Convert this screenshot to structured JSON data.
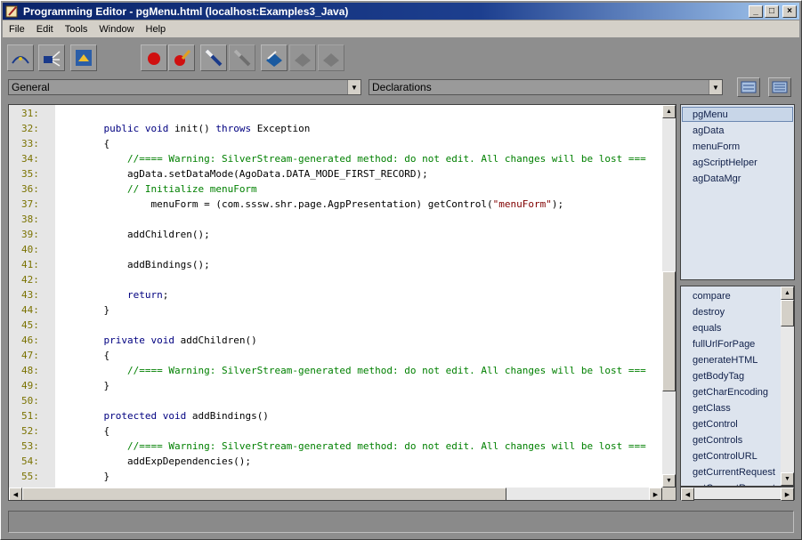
{
  "window": {
    "title": "Programming Editor - pgMenu.html  (localhost:Examples3_Java)"
  },
  "title_buttons": {
    "minimize": "_",
    "maximize": "□",
    "close": "×"
  },
  "menu": [
    "File",
    "Edit",
    "Tools",
    "Window",
    "Help"
  ],
  "toolbar": {
    "icons": [
      "compile-icon",
      "debug-icon",
      "deploy-icon",
      "breakpoint-icon",
      "clear-breakpoint-icon",
      "step-into-icon",
      "step-over-icon",
      "bookmark-icon",
      "prev-bookmark-icon",
      "next-bookmark-icon"
    ]
  },
  "selectors": {
    "object": "General",
    "procedure": "Declarations"
  },
  "editor": {
    "lines": [
      {
        "n": "31:",
        "parts": [
          {
            "t": "",
            "c": ""
          }
        ]
      },
      {
        "n": "32:",
        "parts": [
          {
            "t": "    ",
            "c": ""
          },
          {
            "t": "public void",
            "c": "kw"
          },
          {
            "t": " init() ",
            "c": ""
          },
          {
            "t": "throws",
            "c": "kw"
          },
          {
            "t": " Exception",
            "c": ""
          }
        ]
      },
      {
        "n": "33:",
        "parts": [
          {
            "t": "    {",
            "c": ""
          }
        ]
      },
      {
        "n": "34:",
        "parts": [
          {
            "t": "        ",
            "c": ""
          },
          {
            "t": "//==== Warning: SilverStream-generated method: do not edit. All changes will be lost ===",
            "c": "cm"
          }
        ]
      },
      {
        "n": "35:",
        "parts": [
          {
            "t": "        agData.setDataMode(AgoData.DATA_MODE_FIRST_RECORD);",
            "c": ""
          }
        ]
      },
      {
        "n": "36:",
        "parts": [
          {
            "t": "        ",
            "c": ""
          },
          {
            "t": "// Initialize menuForm",
            "c": "cm"
          }
        ]
      },
      {
        "n": "37:",
        "parts": [
          {
            "t": "            menuForm = (com.sssw.shr.page.AgpPresentation) getControl(",
            "c": ""
          },
          {
            "t": "\"menuForm\"",
            "c": "st"
          },
          {
            "t": ");",
            "c": ""
          }
        ]
      },
      {
        "n": "38:",
        "parts": [
          {
            "t": "",
            "c": ""
          }
        ]
      },
      {
        "n": "39:",
        "parts": [
          {
            "t": "        addChildren();",
            "c": ""
          }
        ]
      },
      {
        "n": "40:",
        "parts": [
          {
            "t": "",
            "c": ""
          }
        ]
      },
      {
        "n": "41:",
        "parts": [
          {
            "t": "        addBindings();",
            "c": ""
          }
        ]
      },
      {
        "n": "42:",
        "parts": [
          {
            "t": "",
            "c": ""
          }
        ]
      },
      {
        "n": "43:",
        "parts": [
          {
            "t": "        ",
            "c": ""
          },
          {
            "t": "return",
            "c": "kw"
          },
          {
            "t": ";",
            "c": ""
          }
        ]
      },
      {
        "n": "44:",
        "parts": [
          {
            "t": "    }",
            "c": ""
          }
        ]
      },
      {
        "n": "45:",
        "parts": [
          {
            "t": "",
            "c": ""
          }
        ]
      },
      {
        "n": "46:",
        "parts": [
          {
            "t": "    ",
            "c": ""
          },
          {
            "t": "private void",
            "c": "kw"
          },
          {
            "t": " addChildren()",
            "c": ""
          }
        ]
      },
      {
        "n": "47:",
        "parts": [
          {
            "t": "    {",
            "c": ""
          }
        ]
      },
      {
        "n": "48:",
        "parts": [
          {
            "t": "        ",
            "c": ""
          },
          {
            "t": "//==== Warning: SilverStream-generated method: do not edit. All changes will be lost ===",
            "c": "cm"
          }
        ]
      },
      {
        "n": "49:",
        "parts": [
          {
            "t": "    }",
            "c": ""
          }
        ]
      },
      {
        "n": "50:",
        "parts": [
          {
            "t": "",
            "c": ""
          }
        ]
      },
      {
        "n": "51:",
        "parts": [
          {
            "t": "    ",
            "c": ""
          },
          {
            "t": "protected void",
            "c": "kw"
          },
          {
            "t": " addBindings()",
            "c": ""
          }
        ]
      },
      {
        "n": "52:",
        "parts": [
          {
            "t": "    {",
            "c": ""
          }
        ]
      },
      {
        "n": "53:",
        "parts": [
          {
            "t": "        ",
            "c": ""
          },
          {
            "t": "//==== Warning: SilverStream-generated method: do not edit. All changes will be lost ===",
            "c": "cm"
          }
        ]
      },
      {
        "n": "54:",
        "parts": [
          {
            "t": "        addExpDependencies();",
            "c": ""
          }
        ]
      },
      {
        "n": "55:",
        "parts": [
          {
            "t": "    }",
            "c": ""
          }
        ]
      }
    ]
  },
  "objects_panel": {
    "items": [
      "pgMenu",
      "agData",
      "menuForm",
      "agScriptHelper",
      "agDataMgr"
    ],
    "selected": "pgMenu"
  },
  "methods_panel": {
    "items": [
      "compare",
      "destroy",
      "equals",
      "fullUrlForPage",
      "generateHTML",
      "getBodyTag",
      "getCharEncoding",
      "getClass",
      "getControl",
      "getControls",
      "getControlURL",
      "getCurrentRequest",
      "getCurrentRequest"
    ]
  },
  "colors": {
    "keyword": "#000080",
    "comment": "#008000",
    "string": "#800000",
    "line_number": "#7a7200",
    "title_bar": "#0a246a"
  }
}
